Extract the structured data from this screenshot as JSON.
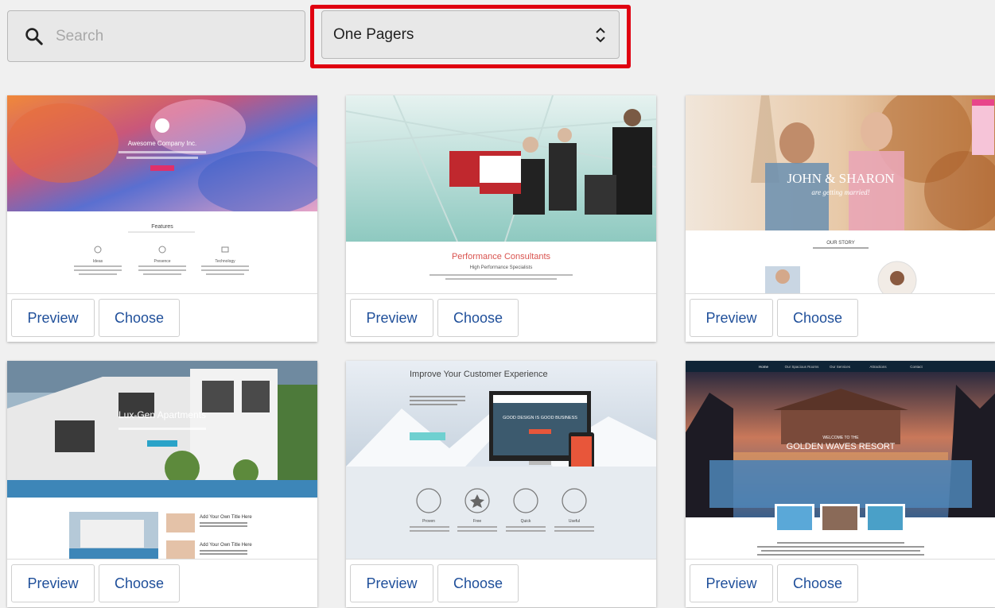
{
  "search": {
    "placeholder": "Search",
    "value": ""
  },
  "filter": {
    "selected": "One Pagers"
  },
  "buttons": {
    "preview": "Preview",
    "choose": "Choose"
  },
  "templates": [
    {
      "title": "Awesome Company Inc.",
      "section_heading": "Features",
      "features": [
        "Ideas",
        "Presence",
        "Technology"
      ]
    },
    {
      "title": "Performance Consultants",
      "subtitle": "High Performance Specialists"
    },
    {
      "title": "JOHN & SHARON",
      "subtitle": "are getting married!",
      "section_heading": "OUR STORY"
    },
    {
      "title": "Lux-Gen Apartments",
      "section_heading": "Add Your Own Title Here",
      "section_heading_2": "Add Your Own Title Here"
    },
    {
      "title": "Improve Your Customer Experience",
      "screen_text": "GOOD DESIGN IS GOOD BUSINESS",
      "features": [
        "Proven",
        "Free",
        "Quick",
        "Useful"
      ]
    },
    {
      "title": "GOLDEN WAVES RESORT",
      "subtitle": "WELCOME TO THE",
      "nav": [
        "Home",
        "Our Spacious Rooms",
        "Our Services",
        "Attractions",
        "Contact"
      ]
    }
  ],
  "colors": {
    "accent": "#1f4f9a",
    "highlight": "#e00010",
    "background": "#f0f0f0"
  }
}
